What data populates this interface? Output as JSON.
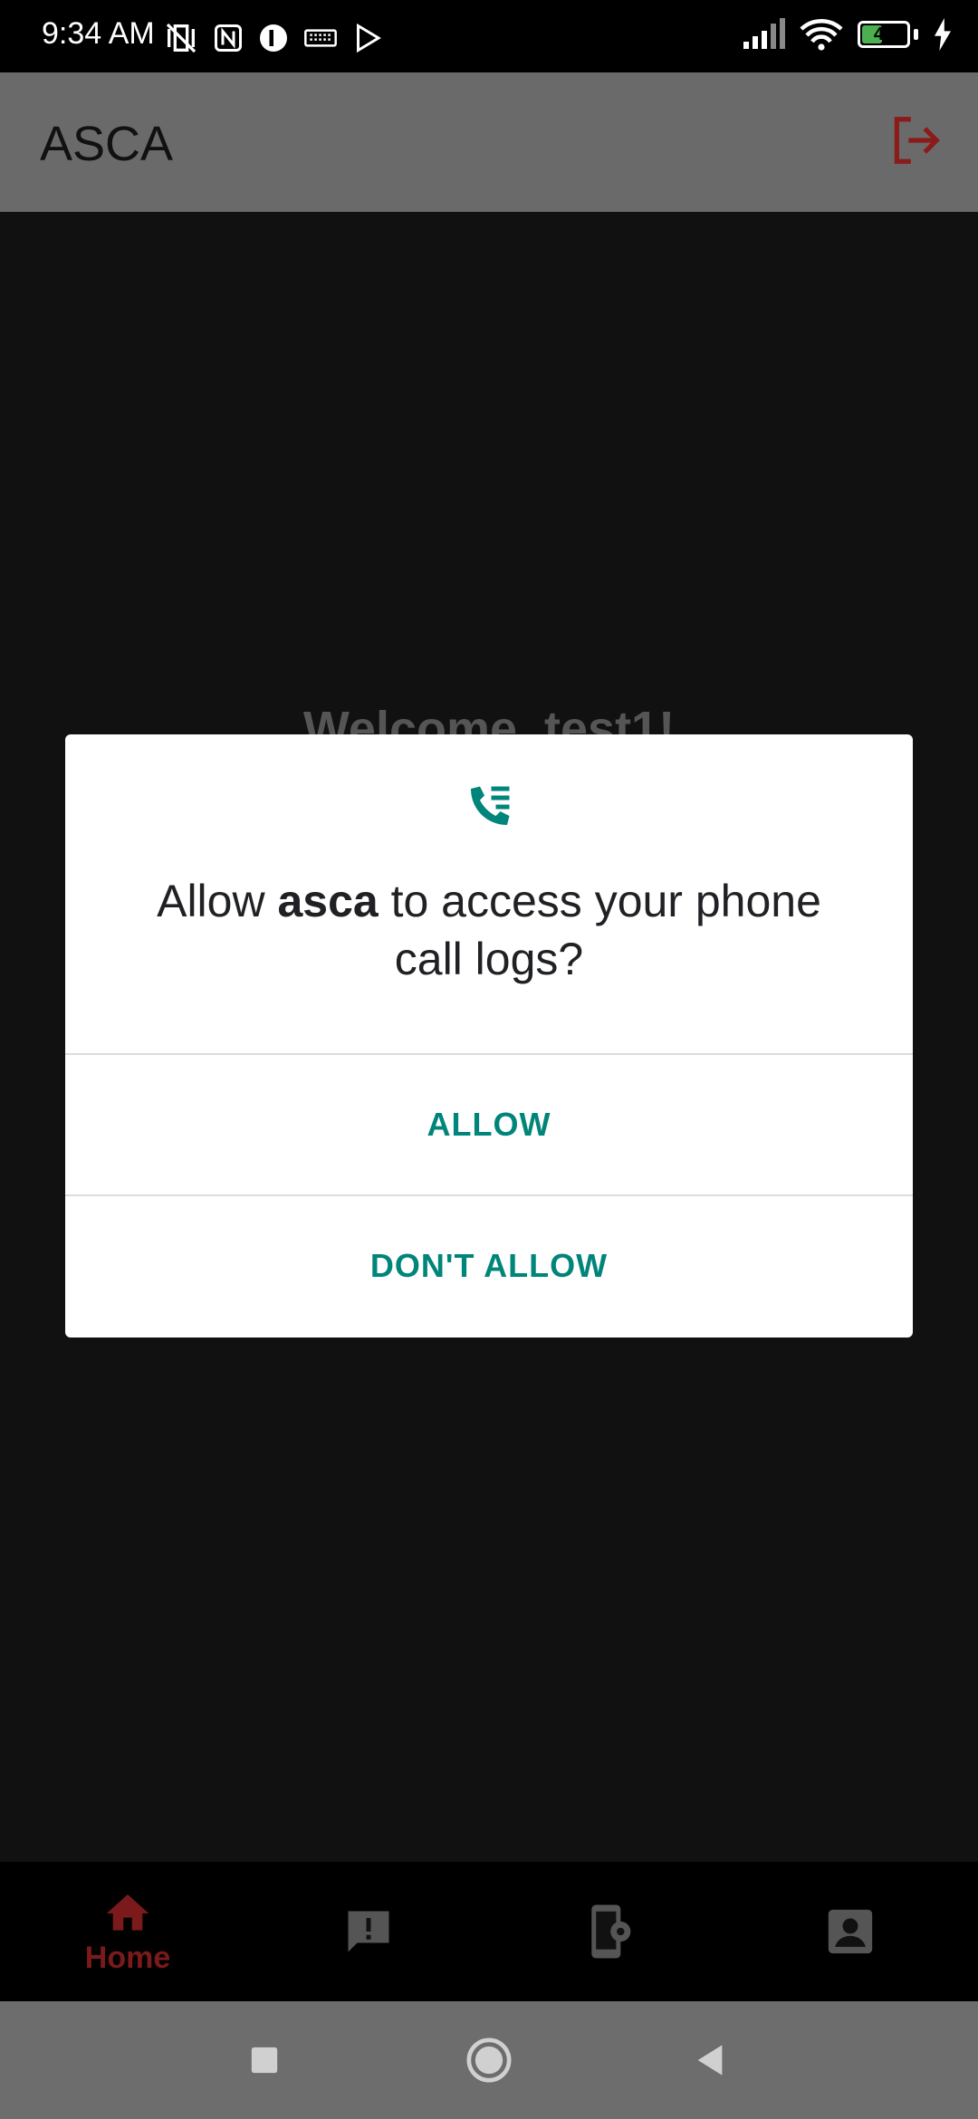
{
  "status_bar": {
    "time": "9:34 AM",
    "battery": "43",
    "icons_left": [
      "vibrate-icon",
      "nfc-icon",
      "app-icon",
      "keyboard-icon",
      "play-icon"
    ],
    "icons_right": [
      "signal-icon",
      "wifi-icon",
      "battery-icon",
      "charging-icon"
    ]
  },
  "app_bar": {
    "title": "ASCA",
    "logout_icon": "logout-icon",
    "accent_color": "#8b1a1a"
  },
  "main": {
    "welcome_text": "Welcome, test1!"
  },
  "dialog": {
    "icon": "call-log-icon",
    "message_prefix": "Allow ",
    "app_name": "asca",
    "message_suffix": " to access your phone call logs?",
    "allow_label": "ALLOW",
    "deny_label": "DON'T ALLOW",
    "button_color": "#00857a"
  },
  "bottom_nav": {
    "items": [
      {
        "label": "Home",
        "icon": "home-icon",
        "active": true
      },
      {
        "label": "",
        "icon": "alert-icon",
        "active": false
      },
      {
        "label": "",
        "icon": "device-settings-icon",
        "active": false
      },
      {
        "label": "",
        "icon": "account-icon",
        "active": false
      }
    ]
  },
  "system_nav": {
    "icons": [
      "recents-icon",
      "home-circle-icon",
      "back-icon"
    ]
  }
}
